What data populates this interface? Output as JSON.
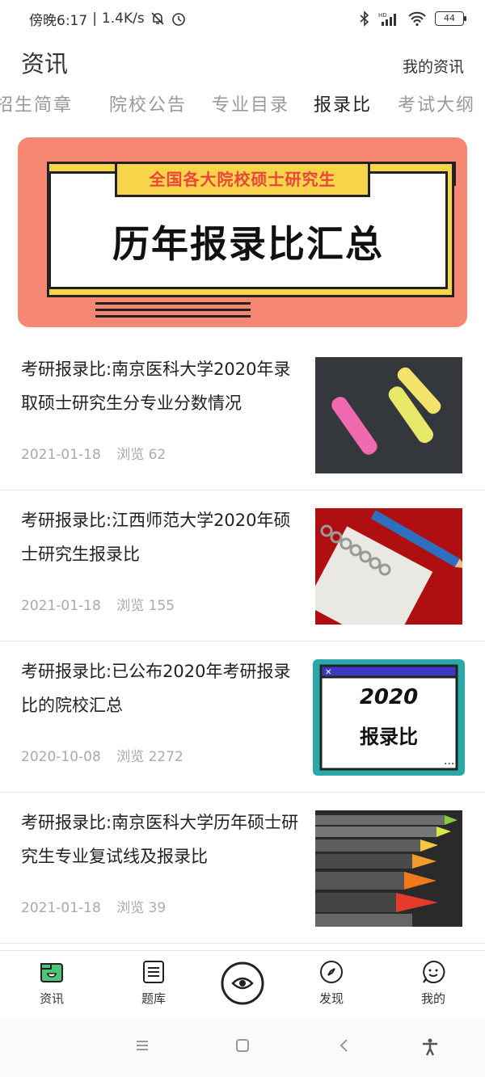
{
  "status_bar": {
    "time": "傍晚6:17",
    "network_speed": "1.4K/s",
    "battery": "44",
    "icons": [
      "mute-bell-icon",
      "alarm-icon",
      "bluetooth-icon",
      "hd-signal-icon",
      "wifi-icon",
      "battery-icon"
    ]
  },
  "header": {
    "title": "资讯",
    "my_news": "我的资讯"
  },
  "tabs": [
    {
      "label": "招生简章",
      "active": false
    },
    {
      "label": "院校公告",
      "active": false
    },
    {
      "label": "专业目录",
      "active": false
    },
    {
      "label": "报录比",
      "active": true
    },
    {
      "label": "考试大纲",
      "active": false
    }
  ],
  "banner": {
    "tag": "全国各大院校硕士研究生",
    "title": "历年报录比汇总",
    "colors": {
      "background": "#f68773",
      "accent": "#f8d44a",
      "tag_text": "#e8453c"
    }
  },
  "articles": [
    {
      "title": "考研报录比:南京医科大学2020年录取硕士研究生分专业分数情况",
      "date": "2021-01-18",
      "views_label": "浏览",
      "views": "62",
      "thumb": "chalk-image"
    },
    {
      "title": "考研报录比:江西师范大学2020年硕士研究生报录比",
      "date": "2021-01-18",
      "views_label": "浏览",
      "views": "155",
      "thumb": "pencil-notebook-image"
    },
    {
      "title": "考研报录比:已公布2020年考研报录比的院校汇总",
      "date": "2020-10-08",
      "views_label": "浏览",
      "views": "2272",
      "thumb": "window-graphic-image",
      "thumb_text_1": "2020",
      "thumb_text_2": "报录比"
    },
    {
      "title": "考研报录比:南京医科大学历年硕士研究生专业复试线及报录比",
      "date": "2021-01-18",
      "views_label": "浏览",
      "views": "39",
      "thumb": "crayons-image"
    }
  ],
  "bottom_nav": [
    {
      "label": "资讯",
      "icon": "news-icon",
      "active": true
    },
    {
      "label": "题库",
      "icon": "question-bank-icon",
      "active": false
    },
    {
      "label": "",
      "icon": "center-eye-icon",
      "active": false
    },
    {
      "label": "发现",
      "icon": "compass-icon",
      "active": false
    },
    {
      "label": "我的",
      "icon": "profile-face-icon",
      "active": false
    }
  ],
  "system_nav": [
    "menu-icon",
    "home-icon",
    "back-icon",
    "accessibility-icon"
  ]
}
